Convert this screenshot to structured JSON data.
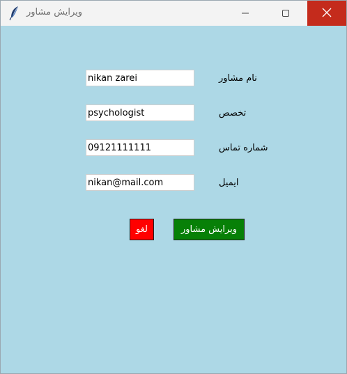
{
  "window": {
    "title": "ویرایش مشاور",
    "icons": {
      "app": "feather-icon",
      "minimize": "minimize-icon",
      "maximize": "maximize-icon",
      "close": "close-icon"
    }
  },
  "form": {
    "name_label": "نام مشاور",
    "name_value": "nikan zarei",
    "specialty_label": "تخصص",
    "specialty_value": "psychologist",
    "phone_label": "شماره تماس",
    "phone_value": "09121111111",
    "email_label": "ایمیل",
    "email_value": "nikan@mail.com"
  },
  "actions": {
    "cancel_label": "لغو",
    "edit_label": "ویرایش مشاور"
  },
  "colors": {
    "background": "#add8e6",
    "cancel": "#ff0000",
    "edit": "#078007",
    "close_hover": "#c42b1c"
  }
}
